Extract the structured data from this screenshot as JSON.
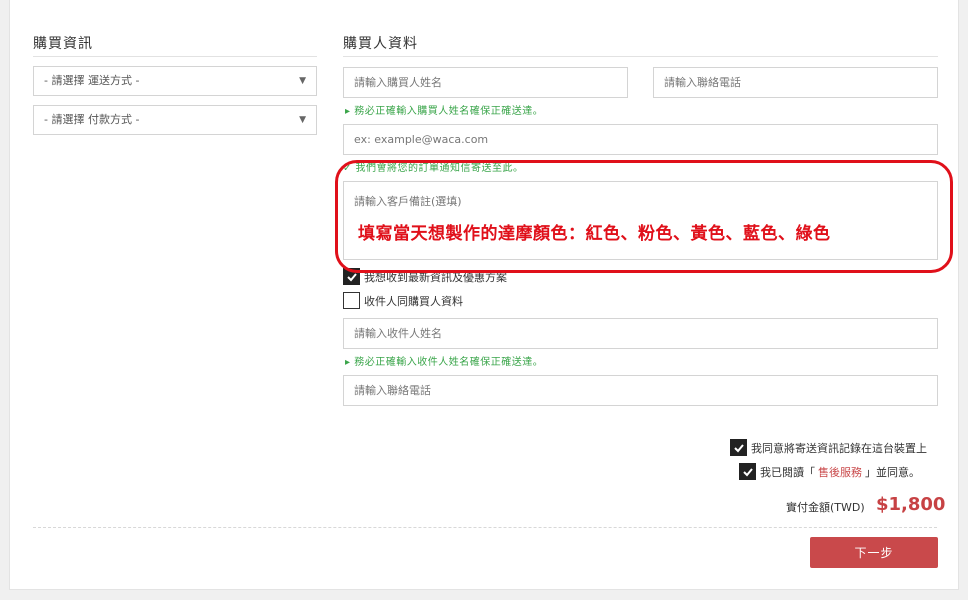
{
  "left_section": {
    "title": "購買資訊",
    "shipping_select": "- 請選擇 運送方式 -",
    "payment_select": "- 請選擇 付款方式 -"
  },
  "right_section": {
    "title": "購買人資料",
    "buyer_name_placeholder": "請輸入購買人姓名",
    "buyer_phone_placeholder": "請輸入聯絡電話",
    "buyer_name_hint": "▸ 務必正確輸入購買人姓名確保正確送達。",
    "email_placeholder": "ex: example@waca.com",
    "email_hint": "✓ 我們會將您的訂單通知信寄送至此。",
    "note_placeholder": "請輸入客戶備註(選填)",
    "newsletter_label": "我想收到最新資訊及優惠方案",
    "same_as_buyer_label": "收件人同購買人資料",
    "recipient_name_placeholder": "請輸入收件人姓名",
    "recipient_name_hint": "▸ 務必正確輸入收件人姓名確保正確送達。",
    "recipient_phone_placeholder": "請輸入聯絡電話"
  },
  "annotation": {
    "text": "填寫當天想製作的達摩顏色：紅色、粉色、黃色、藍色、綠色",
    "color": "#e0101a"
  },
  "agreements": {
    "remember_label": "我同意將寄送資訊記錄在這台裝置上",
    "terms_prefix": "我已閱讀「",
    "terms_link": "售後服務",
    "terms_suffix": "」並同意。"
  },
  "total": {
    "label": "實付金額(TWD)",
    "amount": "$1,800"
  },
  "next_button": "下一步",
  "colors": {
    "accent": "#c9494b",
    "hint_green": "#3aa54a"
  }
}
